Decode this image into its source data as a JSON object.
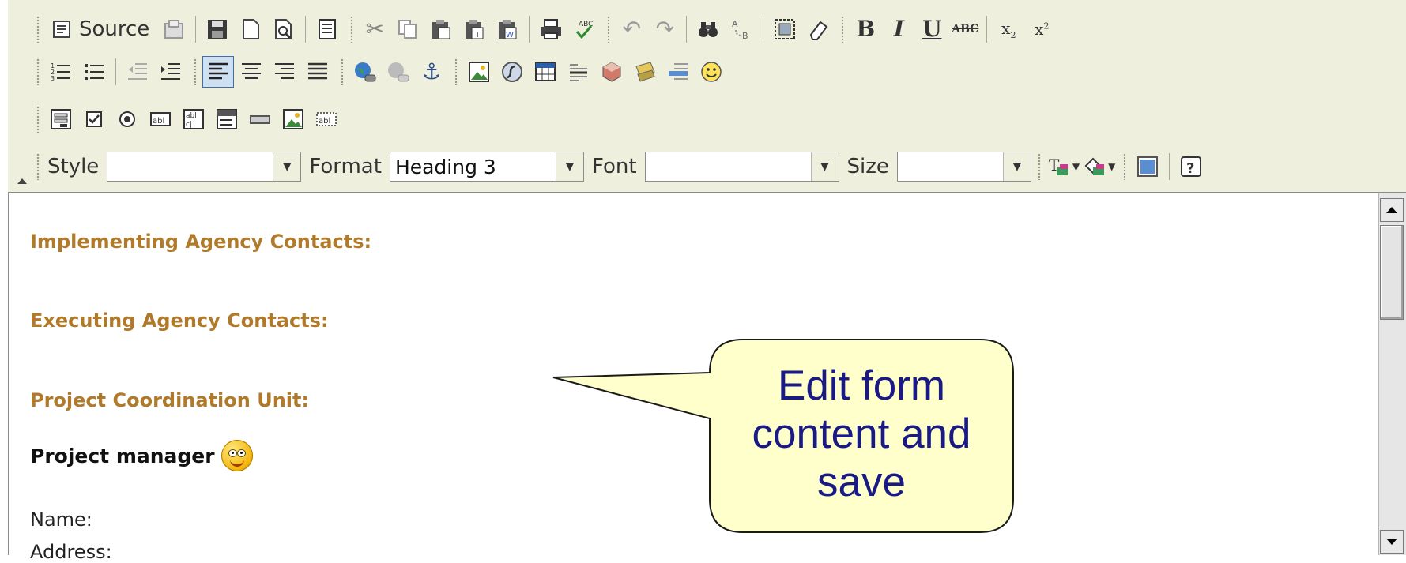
{
  "toolbar": {
    "row1": {
      "source_label": "Source"
    },
    "row4": {
      "style": {
        "label": "Style",
        "value": ""
      },
      "format": {
        "label": "Format",
        "value": "Heading 3"
      },
      "font": {
        "label": "Font",
        "value": ""
      },
      "size": {
        "label": "Size",
        "value": ""
      }
    }
  },
  "content": {
    "headings": [
      "Implementing Agency Contacts:",
      "Executing Agency Contacts:",
      "Project Coordination Unit:"
    ],
    "project_manager": "Project manager",
    "fields": [
      "Name:",
      "Address:"
    ]
  },
  "callout": {
    "text": "Edit form content and save",
    "lines": [
      "Edit form",
      "content and",
      "save"
    ]
  },
  "colors": {
    "toolbar_bg": "#efefde",
    "heading": "#b07a2a",
    "callout_fill": "#ffffcc",
    "callout_text": "#1a1a86",
    "active_button": "#cfe0f3"
  }
}
